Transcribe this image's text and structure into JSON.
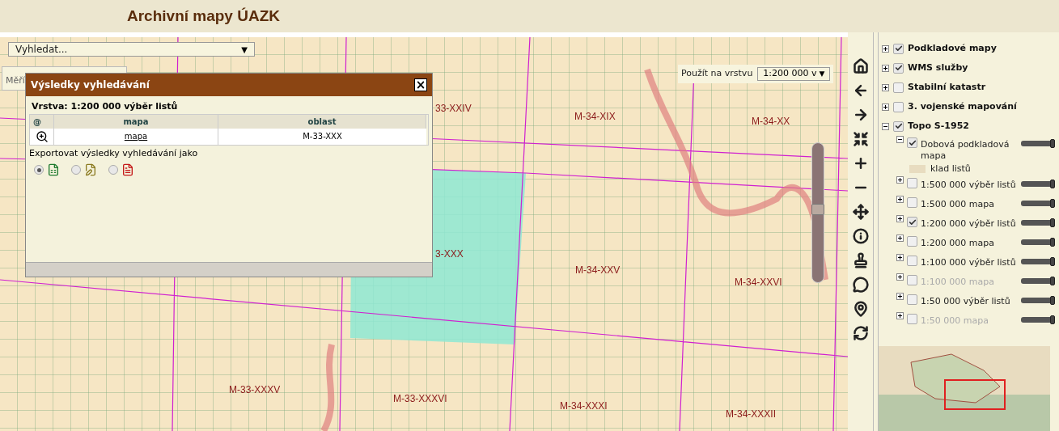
{
  "header": {
    "title": "Archivní mapy ÚAZK"
  },
  "search": {
    "value": "Vyhledat...",
    "arrow": "▼"
  },
  "scale": {
    "label": "Měří"
  },
  "apply_layer": {
    "label": "Použít na vrstvu",
    "value": "1:200 000 v",
    "arrow": "▼"
  },
  "zoom_slider": {
    "level": 0.5
  },
  "map_labels": [
    "33-XXIV",
    "M-34-XIX",
    "M-34-XX",
    "3-XXX",
    "M-34-XXV",
    "M-34-XXVI",
    "M-33-XXXV",
    "M-33-XXXVI",
    "M-34-XXXI",
    "M-34-XXXII"
  ],
  "dialog": {
    "title": "Výsledky vyhledávání",
    "close": "×",
    "layer": "Vrstva: 1:200 000 výběr listů",
    "columns": [
      "@",
      "mapa",
      "oblast"
    ],
    "rows": [
      {
        "link": "mapa",
        "oblast": "M-33-XXX"
      }
    ],
    "export_label": "Exportovat výsledky vyhledávání jako",
    "export_options": [
      {
        "kind": "excel",
        "selected": true
      },
      {
        "kind": "text",
        "selected": false
      },
      {
        "kind": "pdf",
        "selected": false
      }
    ]
  },
  "layers": [
    {
      "label": "Podkladové mapy",
      "checked": true,
      "expanded": false
    },
    {
      "label": "WMS služby",
      "checked": true,
      "expanded": false
    },
    {
      "label": "Stabilní katastr",
      "checked": false,
      "expanded": false
    },
    {
      "label": "3. vojenské mapování",
      "checked": false,
      "expanded": false
    },
    {
      "label": "Topo S-1952",
      "checked": true,
      "expanded": true,
      "children": [
        {
          "label": "Dobová podkladová mapa",
          "checked": true,
          "expanded": true,
          "disabled": false,
          "level": 1,
          "legend": "klad listů"
        },
        {
          "label": "1:500 000 výběr listů",
          "checked": false,
          "expanded": false,
          "disabled": false,
          "level": 1
        },
        {
          "label": "1:500 000 mapa",
          "checked": false,
          "expanded": false,
          "disabled": false,
          "level": 1
        },
        {
          "label": "1:200 000 výběr listů",
          "checked": true,
          "expanded": false,
          "disabled": false,
          "level": 1
        },
        {
          "label": "1:200 000 mapa",
          "checked": false,
          "expanded": false,
          "disabled": false,
          "level": 1
        },
        {
          "label": "1:100 000 výběr listů",
          "checked": false,
          "expanded": false,
          "disabled": false,
          "level": 1
        },
        {
          "label": "1:100 000 mapa",
          "checked": false,
          "expanded": false,
          "disabled": true,
          "level": 1
        },
        {
          "label": "1:50 000 výběr listů",
          "checked": false,
          "expanded": false,
          "disabled": false,
          "level": 1
        },
        {
          "label": "1:50 000 mapa",
          "checked": false,
          "expanded": false,
          "disabled": true,
          "level": 1
        }
      ]
    }
  ]
}
